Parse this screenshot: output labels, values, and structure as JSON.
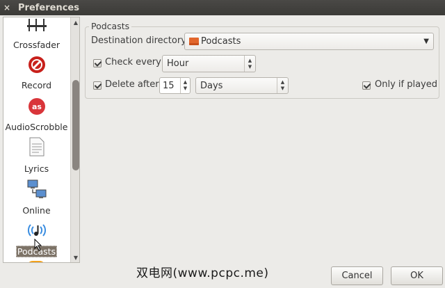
{
  "window": {
    "title": "Preferences",
    "close_glyph": "×"
  },
  "sidebar": {
    "items": [
      {
        "label": "Crossfader",
        "icon": "crossfader-icon"
      },
      {
        "label": "Record",
        "icon": "record-icon"
      },
      {
        "label": "AudioScrobble",
        "icon": "lastfm-icon"
      },
      {
        "label": "Lyrics",
        "icon": "lyrics-document-icon"
      },
      {
        "label": "Online",
        "icon": "network-computers-icon"
      },
      {
        "label": "Podcasts",
        "icon": "podcast-icon",
        "selected": true
      }
    ]
  },
  "podcasts": {
    "group_label": "Podcasts",
    "destination_label": "Destination directory:",
    "destination_value": "Podcasts",
    "check_every_label": "Check every",
    "check_every_checked": true,
    "check_every_value": "Hour",
    "delete_after_label": "Delete after",
    "delete_after_checked": true,
    "delete_after_number": "15",
    "delete_after_unit": "Days",
    "only_if_played_label": "Only if played",
    "only_if_played_checked": true
  },
  "buttons": {
    "cancel": "Cancel",
    "ok": "OK"
  },
  "watermark": "双电网(www.pcpc.me)"
}
